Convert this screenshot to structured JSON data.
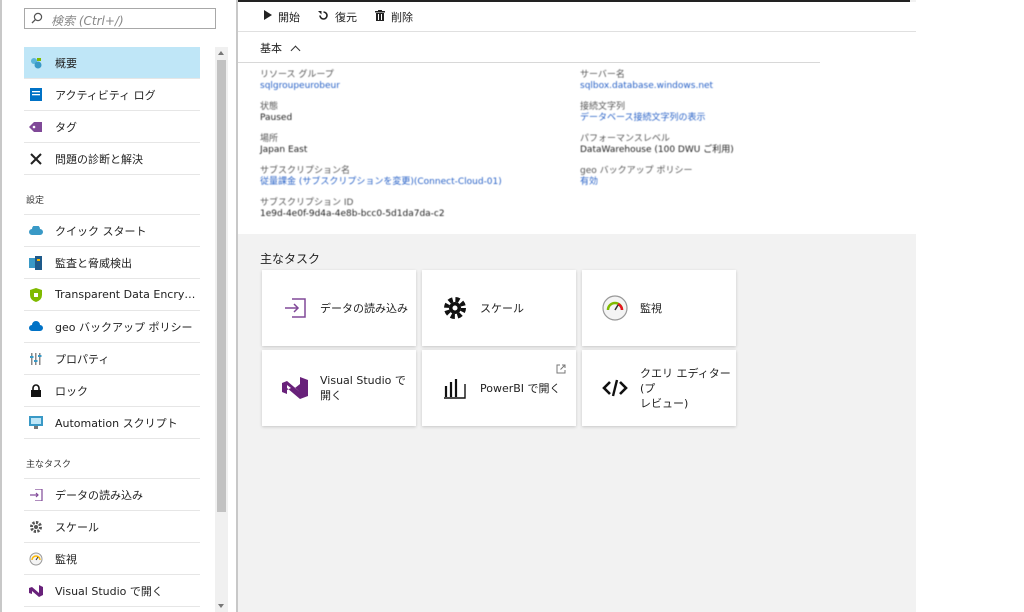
{
  "search": {
    "placeholder": "検索 (Ctrl+/)"
  },
  "sidebar": {
    "items": [
      {
        "label": "概要",
        "icon": "overview-icon",
        "active": true
      },
      {
        "label": "アクティビティ ログ",
        "icon": "activity-log-icon"
      },
      {
        "label": "タグ",
        "icon": "tag-icon"
      },
      {
        "label": "問題の診断と解決",
        "icon": "diagnose-icon"
      }
    ],
    "section_settings": "設定",
    "settings_items": [
      {
        "label": "クイック スタート",
        "icon": "quickstart-cloud-icon"
      },
      {
        "label": "監査と脅威検出",
        "icon": "audit-icon"
      },
      {
        "label": "Transparent Data Encryption",
        "icon": "tde-shield-icon"
      },
      {
        "label": "geo バックアップ ポリシー",
        "icon": "geo-backup-icon"
      },
      {
        "label": "プロパティ",
        "icon": "properties-icon"
      },
      {
        "label": "ロック",
        "icon": "lock-icon"
      },
      {
        "label": "Automation スクリプト",
        "icon": "automation-icon"
      }
    ],
    "section_tasks": "主なタスク",
    "task_items": [
      {
        "label": "データの読み込み",
        "icon": "load-data-icon"
      },
      {
        "label": "スケール",
        "icon": "scale-gear-icon"
      },
      {
        "label": "監視",
        "icon": "monitor-gauge-icon"
      },
      {
        "label": "Visual Studio で開く",
        "icon": "visual-studio-icon"
      }
    ]
  },
  "toolbar": {
    "start": "開始",
    "restore": "復元",
    "delete": "削除"
  },
  "essentials": {
    "header": "基本",
    "left": [
      {
        "key": "リソース グループ",
        "value": "sqlgroupeurobeur",
        "link": true
      },
      {
        "key": "状態",
        "value": "Paused",
        "link": false
      },
      {
        "key": "場所",
        "value": "Japan East",
        "link": false
      },
      {
        "key": "サブスクリプション名",
        "value": "従量課金 (サブスクリプションを変更)(Connect-Cloud-01)",
        "link": true
      },
      {
        "key": "サブスクリプション ID",
        "value": "1e9d-4e0f-9d4a-4e8b-bcc0-5d1da7da-c2",
        "link": false
      }
    ],
    "right": [
      {
        "key": "サーバー名",
        "value": "sqlbox.database.windows.net",
        "link": true
      },
      {
        "key": "接続文字列",
        "value": "データベース接続文字列の表示",
        "link": true
      },
      {
        "key": "パフォーマンスレベル",
        "value": "DataWarehouse (100 DWU ご利用)",
        "link": false
      },
      {
        "key": "geo バックアップ ポリシー",
        "value": "有効",
        "link": true
      }
    ]
  },
  "tasks": {
    "title": "主なタスク",
    "tiles": [
      {
        "label": "データの読み込み",
        "icon": "load-data-icon"
      },
      {
        "label": "スケール",
        "icon": "scale-gear-icon"
      },
      {
        "label": "監視",
        "icon": "monitor-gauge-icon"
      },
      {
        "label_line1": "Visual Studio で",
        "label_line2": "開く",
        "icon": "visual-studio-icon"
      },
      {
        "label": "PowerBI で開く",
        "icon": "powerbi-icon",
        "external": true
      },
      {
        "label_line1": "クエリ エディター (プ",
        "label_line2": "レビュー)",
        "icon": "query-editor-icon"
      }
    ]
  },
  "colors": {
    "active_bg": "#bfe6f7",
    "accent": "#0072c6",
    "link": "#2a63c7"
  }
}
